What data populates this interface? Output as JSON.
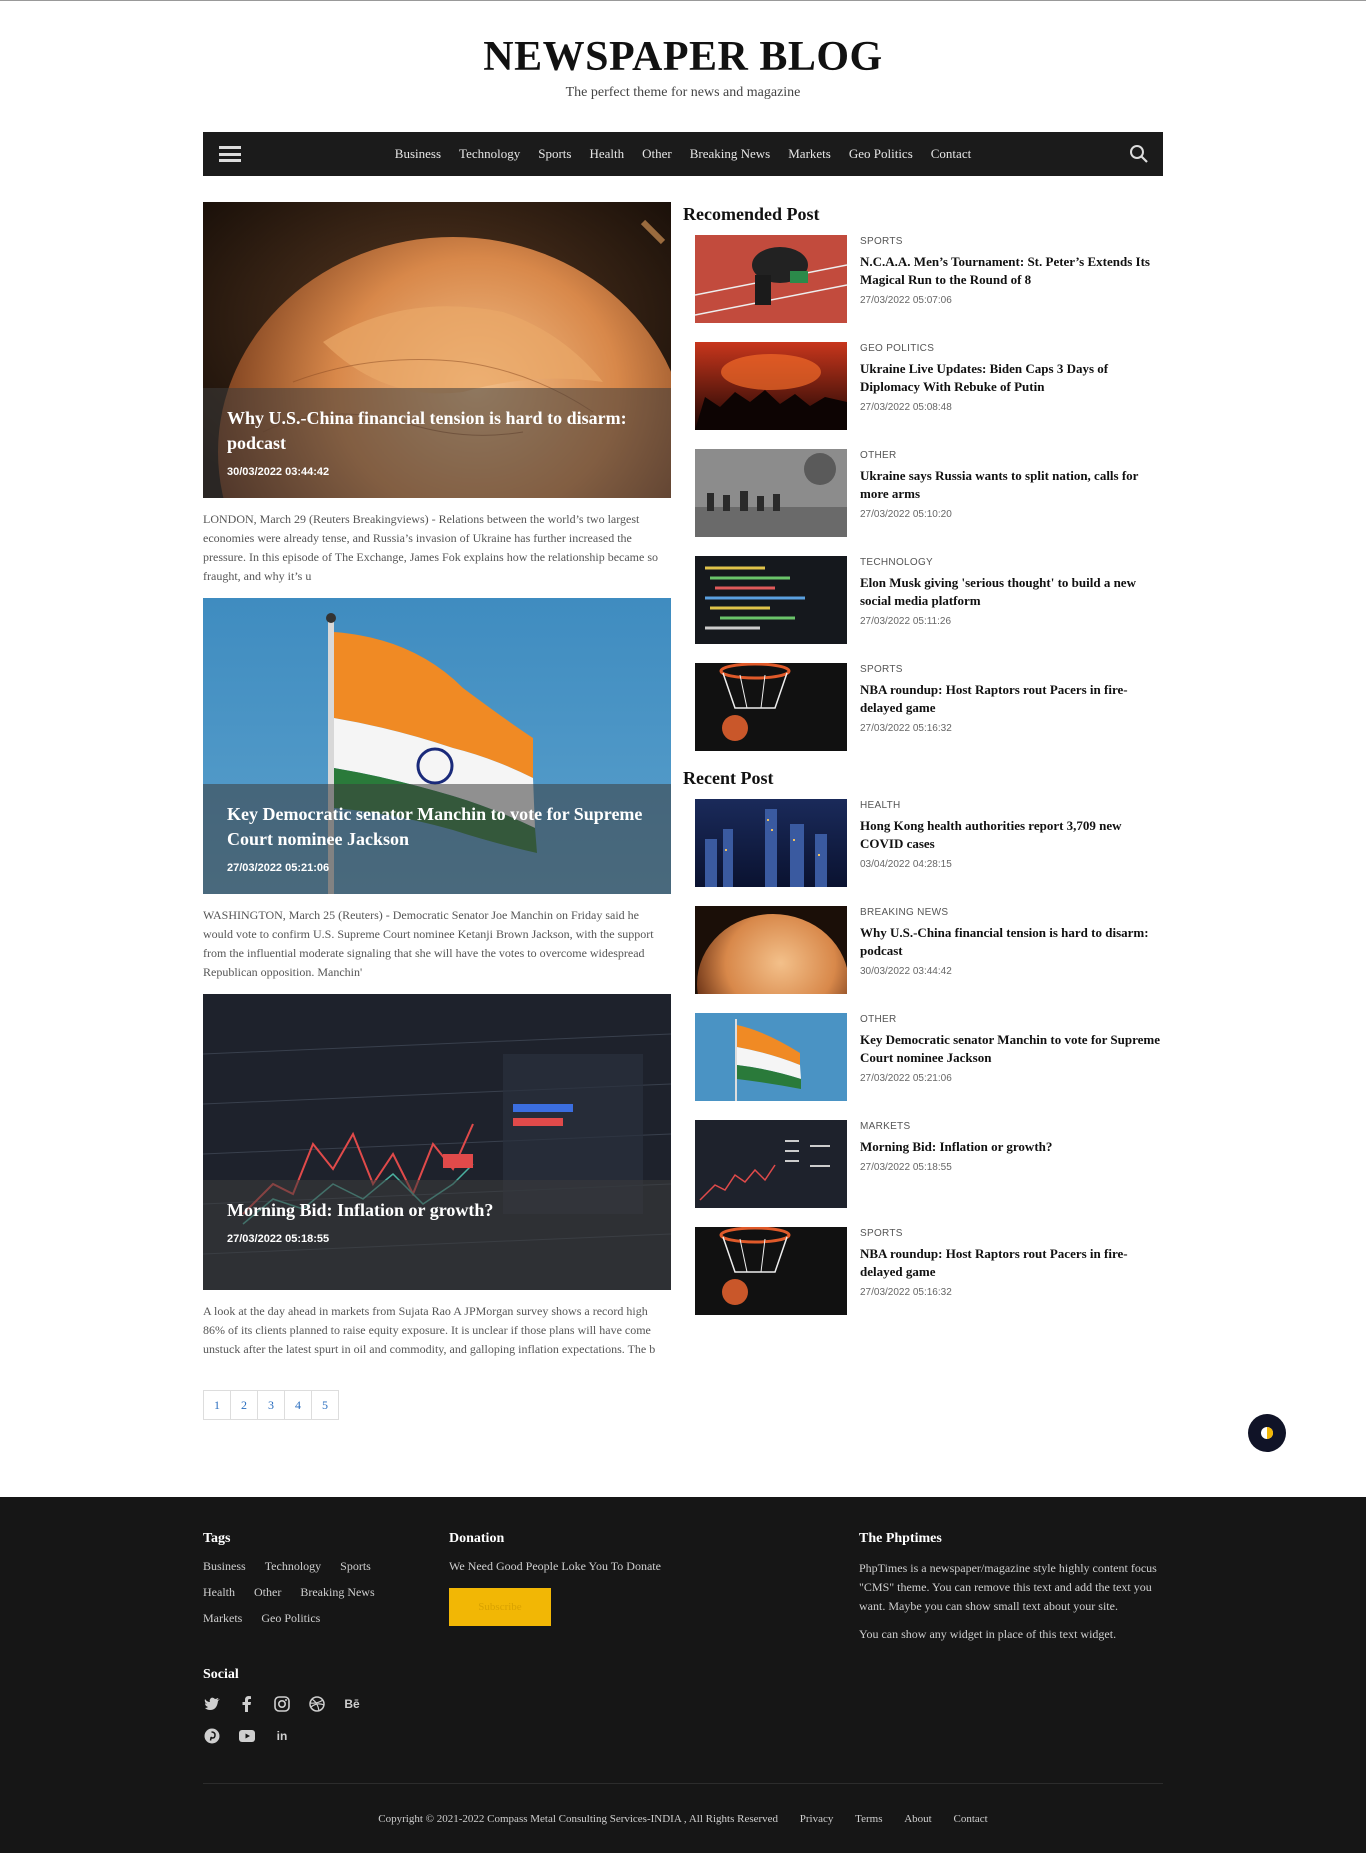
{
  "site": {
    "title": "NEWSPAPER BLOG",
    "tagline": "The perfect theme for news and magazine"
  },
  "nav": {
    "items": [
      "Business",
      "Technology",
      "Sports",
      "Health",
      "Other",
      "Breaking News",
      "Markets",
      "Geo Politics",
      "Contact"
    ]
  },
  "featured": [
    {
      "title": "Why U.S.-China financial tension is hard to disarm: podcast",
      "date": "30/03/2022 03:44:42",
      "excerpt": "LONDON, March 29 (Reuters Breakingviews) - Relations between the world’s two largest economies were already tense, and Russia’s invasion of Ukraine has further increased the pressure. In this episode of The Exchange, James Fok explains how the relationship became so fraught, and why it’s u",
      "image": "globe"
    },
    {
      "title": "Key Democratic senator Manchin to vote for Supreme Court nominee Jackson",
      "date": "27/03/2022 05:21:06",
      "excerpt": "WASHINGTON, March 25 (Reuters) - Democratic Senator Joe Manchin on Friday said he would vote to confirm U.S. Supreme Court nominee Ketanji Brown Jackson, with the support from the influential moderate signaling that she will have the votes to overcome widespread Republican opposition. Manchin'",
      "image": "flag"
    },
    {
      "title": "Morning Bid: Inflation or growth?",
      "date": "27/03/2022 05:18:55",
      "excerpt": "A look at the day ahead in markets from Sujata Rao A JPMorgan survey shows a record high 86% of its clients planned to raise equity exposure. It is unclear if those plans will have come unstuck after the latest spurt in oil and commodity, and galloping inflation expectations. The b",
      "image": "market"
    }
  ],
  "pagination": [
    "1",
    "2",
    "3",
    "4",
    "5"
  ],
  "recommended": {
    "heading": "Recomended Post",
    "posts": [
      {
        "category": "SPORTS",
        "title": "N.C.A.A. Men’s Tournament: St. Peter’s Extends Its Magical Run to the Round of 8",
        "date": "27/03/2022 05:07:06",
        "image": "track"
      },
      {
        "category": "GEO POLITICS",
        "title": "Ukraine Live Updates: Biden Caps 3 Days of Diplomacy With Rebuke of Putin",
        "date": "27/03/2022 05:08:48",
        "image": "fire"
      },
      {
        "category": "OTHER",
        "title": "Ukraine says Russia wants to split nation, calls for more arms",
        "date": "27/03/2022 05:10:20",
        "image": "soldiers"
      },
      {
        "category": "TECHNOLOGY",
        "title": "Elon Musk giving 'serious thought' to build a new social media platform",
        "date": "27/03/2022 05:11:26",
        "image": "code"
      },
      {
        "category": "SPORTS",
        "title": "NBA roundup: Host Raptors rout Pacers in fire-delayed game",
        "date": "27/03/2022 05:16:32",
        "image": "basketball"
      }
    ]
  },
  "recent": {
    "heading": "Recent Post",
    "posts": [
      {
        "category": "HEALTH",
        "title": "Hong Kong health authorities report 3,709 new COVID cases",
        "date": "03/04/2022 04:28:15",
        "image": "city"
      },
      {
        "category": "BREAKING NEWS",
        "title": "Why U.S.-China financial tension is hard to disarm: podcast",
        "date": "30/03/2022 03:44:42",
        "image": "globe"
      },
      {
        "category": "OTHER",
        "title": "Key Democratic senator Manchin to vote for Supreme Court nominee Jackson",
        "date": "27/03/2022 05:21:06",
        "image": "flag"
      },
      {
        "category": "MARKETS",
        "title": "Morning Bid: Inflation or growth?",
        "date": "27/03/2022 05:18:55",
        "image": "market"
      },
      {
        "category": "SPORTS",
        "title": "NBA roundup: Host Raptors rout Pacers in fire-delayed game",
        "date": "27/03/2022 05:16:32",
        "image": "basketball"
      }
    ]
  },
  "footer": {
    "tags_heading": "Tags",
    "tags": [
      "Business",
      "Technology",
      "Sports",
      "Health",
      "Other",
      "Breaking News",
      "Markets",
      "Geo Politics"
    ],
    "donation_heading": "Donation",
    "donation_text": "We Need Good People Loke You To Donate",
    "subscribe_label": "Subscribe",
    "about_heading": "The Phptimes",
    "about_p1": "PhpTimes is a newspaper/magazine style highly content focus \"CMS\" theme. You can remove this text and add the text you want. Maybe you can show small text about your site.",
    "about_p2": "You can show any widget in place of this text widget.",
    "social_heading": "Social",
    "social_icons": [
      "twitter-icon",
      "facebook-icon",
      "instagram-icon",
      "dribbble-icon",
      "behance-icon",
      "pinterest-icon",
      "youtube-icon",
      "linkedin-icon"
    ],
    "copyright": "Copyright © 2021-2022 Compass Metal Consulting Services-INDIA , All Rights Reserved",
    "links": [
      "Privacy",
      "Terms",
      "About",
      "Contact"
    ]
  }
}
